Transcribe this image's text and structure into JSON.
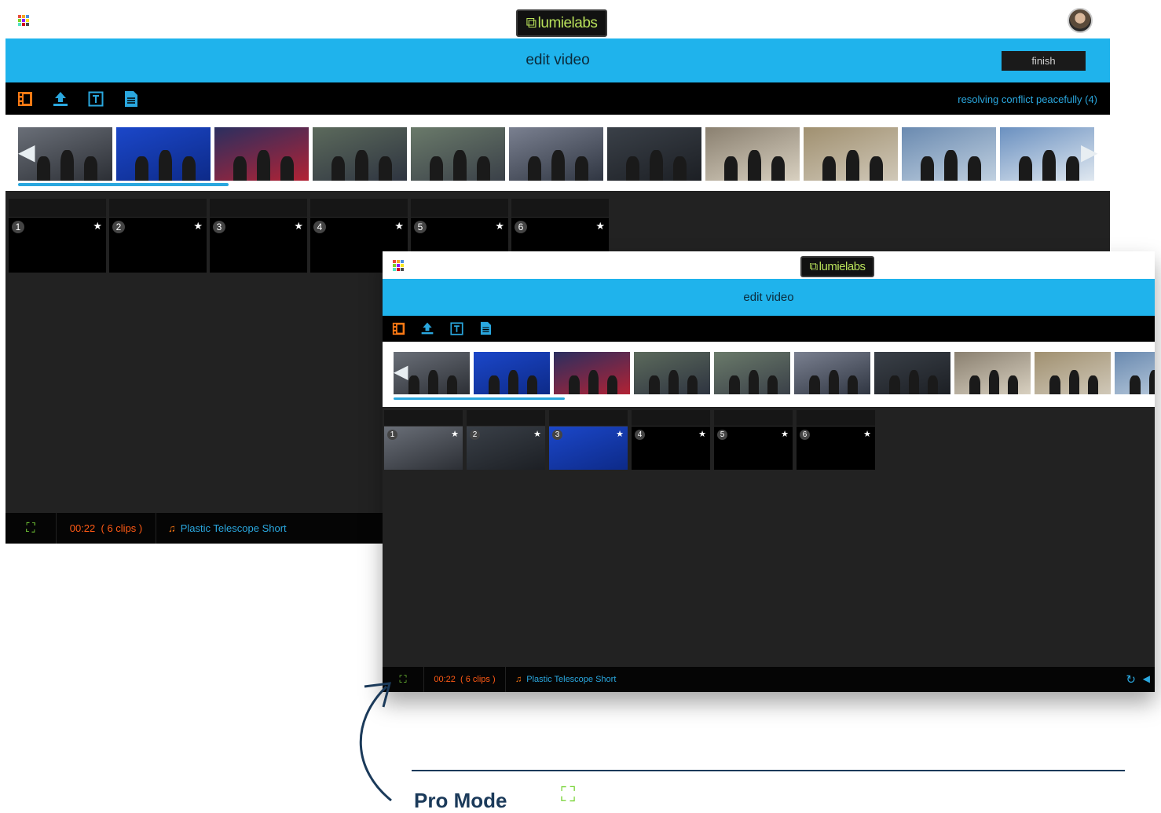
{
  "app": {
    "logo_text": "lumielabs"
  },
  "colors": {
    "accent_blue": "#1fb3ec",
    "timeline_orange": "#ff5a14",
    "music_blue": "#2aa7de",
    "focus_green": "#7ad43a"
  },
  "back_window": {
    "title": "edit video",
    "finish_label": "finish",
    "project_name": "resolving conflict peacefully (4)",
    "toolbar_icons": [
      "film-clip-icon",
      "upload-icon",
      "text-icon",
      "document-icon"
    ],
    "slots": [
      {
        "num": "1",
        "star": "★"
      },
      {
        "num": "2",
        "star": "★"
      },
      {
        "num": "3",
        "star": "★"
      },
      {
        "num": "4",
        "star": "★"
      },
      {
        "num": "5",
        "star": "★"
      },
      {
        "num": "6",
        "star": "★"
      }
    ],
    "footer": {
      "duration": "00:22",
      "clip_count": "( 6 clips )",
      "music": "Plastic Telescope Short"
    }
  },
  "front_window": {
    "title": "edit video",
    "toolbar_icons": [
      "film-clip-icon",
      "upload-icon",
      "text-icon",
      "document-icon"
    ],
    "slots": [
      {
        "num": "1",
        "star": "★"
      },
      {
        "num": "2",
        "star": "★"
      },
      {
        "num": "3",
        "star": "★"
      },
      {
        "num": "4",
        "star": "★"
      },
      {
        "num": "5",
        "star": "★"
      },
      {
        "num": "6",
        "star": "★"
      }
    ],
    "footer": {
      "duration": "00:22",
      "clip_count": "( 6 clips )",
      "music": "Plastic Telescope Short"
    }
  },
  "callout": {
    "title": "Pro Mode"
  }
}
